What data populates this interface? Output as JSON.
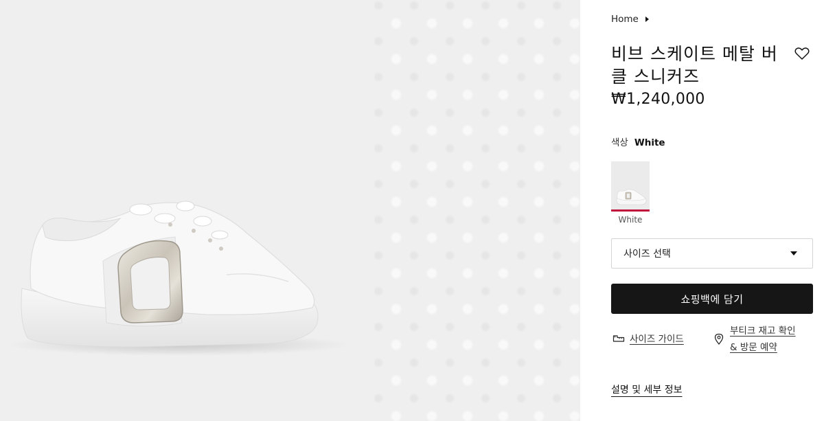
{
  "breadcrumb": {
    "home_label": "Home"
  },
  "product": {
    "title": "비브 스케이트 메탈 버클 스니커즈",
    "price": "₩1,240,000",
    "color_label": "색상",
    "color_value": "White",
    "swatches": [
      {
        "label": "White",
        "selected": true
      }
    ],
    "size_select_placeholder": "사이즈 선택",
    "add_to_bag_label": "쇼핑백에 담기",
    "size_guide_label": "사이즈 가이드",
    "boutique_label": "부티크 재고 확인 & 방문 예약",
    "description_label": "설명 및 세부 정보"
  },
  "icons": {
    "wishlist": "heart-icon",
    "breadcrumb_separator": "caret-right-icon",
    "select_caret": "caret-down-icon",
    "size_guide": "ruler-icon",
    "boutique": "location-pin-icon"
  },
  "colors": {
    "accent_underline": "#c0143c",
    "button_bg": "#161616",
    "gallery_bg": "#efefef"
  }
}
